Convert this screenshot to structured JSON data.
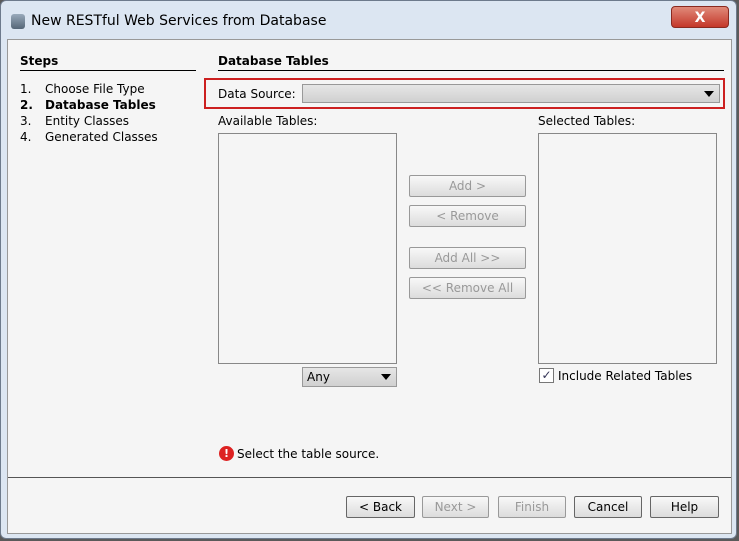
{
  "window": {
    "title": "New RESTful Web Services from Database",
    "close_label": "X"
  },
  "steps": {
    "heading": "Steps",
    "items": [
      {
        "num": "1.",
        "label": "Choose File Type"
      },
      {
        "num": "2.",
        "label": "Database Tables"
      },
      {
        "num": "3.",
        "label": "Entity Classes"
      },
      {
        "num": "4.",
        "label": "Generated Classes"
      }
    ]
  },
  "panel": {
    "heading": "Database Tables",
    "data_source_label": "Data Source:",
    "data_source_value": "",
    "available_label": "Available Tables:",
    "selected_label": "Selected Tables:",
    "filter_value": "Any",
    "include_related_label": "Include Related Tables",
    "include_related_checked": true,
    "add": "Add >",
    "remove": "< Remove",
    "add_all": "Add All >>",
    "remove_all": "<< Remove All",
    "error": "Select the table source."
  },
  "buttons": {
    "back": "< Back",
    "next": "Next >",
    "finish": "Finish",
    "cancel": "Cancel",
    "help": "Help"
  }
}
